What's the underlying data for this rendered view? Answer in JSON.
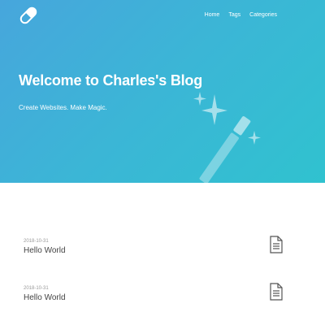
{
  "site": {
    "logo_icon": "pill-icon"
  },
  "nav": {
    "items": [
      {
        "label": "Home"
      },
      {
        "label": "Tags"
      },
      {
        "label": "Categories"
      }
    ]
  },
  "hero": {
    "title": "Welcome to Charles's Blog",
    "subtitle": "Create Websites. Make Magic.",
    "illustration_icon": "magic-wand-icon",
    "gradient_start": "#47a6dc",
    "gradient_end": "#30c2cf"
  },
  "posts": [
    {
      "date": "2018-10-31",
      "title": "Hello World",
      "icon": "document-icon"
    },
    {
      "date": "2018-10-31",
      "title": "Hello World",
      "icon": "document-icon"
    }
  ]
}
